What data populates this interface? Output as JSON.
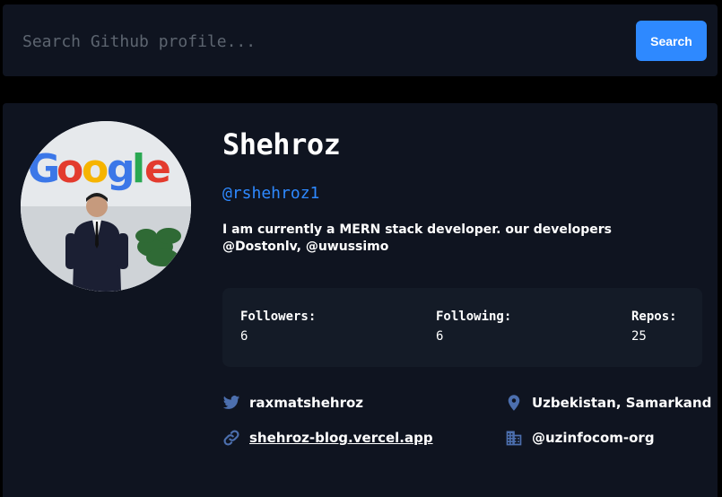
{
  "search": {
    "placeholder": "Search Github profile...",
    "value": "",
    "button_label": "Search"
  },
  "profile": {
    "name": "Shehroz",
    "login": "@rshehroz1",
    "bio": "I am currently a MERN stack developer. our developers @Dostonlv, @uwussimo",
    "stats": {
      "followers_label": "Followers:",
      "followers_value": "6",
      "following_label": "Following:",
      "following_value": "6",
      "repos_label": "Repos:",
      "repos_value": "25"
    },
    "links": {
      "twitter": "raxmatshehroz",
      "blog": "shehroz-blog.vercel.app",
      "location": "Uzbekistan, Samarkand",
      "company": "@uzinfocom-org"
    },
    "avatar_logo_text": "Google"
  },
  "icons": {
    "twitter": "twitter-icon",
    "link": "link-icon",
    "location": "location-pin-icon",
    "company": "building-icon"
  },
  "colors": {
    "background": "#000000",
    "card": "#0f1420",
    "stats_panel": "#141b27",
    "accent": "#2e89ff",
    "icon": "#4c6fae"
  }
}
